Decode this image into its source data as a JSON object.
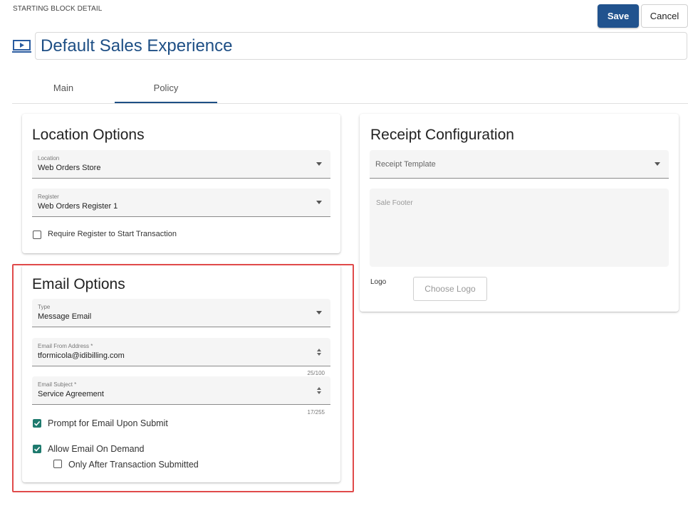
{
  "header": {
    "breadcrumb": "STARTING BLOCK DETAIL",
    "save_label": "Save",
    "cancel_label": "Cancel",
    "title": "Default Sales Experience",
    "title_icon": "presentation-icon"
  },
  "tabs": [
    {
      "label": "Main",
      "active": false
    },
    {
      "label": "Policy",
      "active": true
    }
  ],
  "location_options": {
    "heading": "Location Options",
    "location": {
      "label": "Location",
      "value": "Web Orders Store"
    },
    "register": {
      "label": "Register",
      "value": "Web Orders Register 1"
    },
    "require_register": {
      "label": "Require Register to Start Transaction",
      "checked": false
    }
  },
  "email_options": {
    "heading": "Email Options",
    "type": {
      "label": "Type",
      "value": "Message Email"
    },
    "from_address": {
      "label": "Email From Address *",
      "value": "tformicola@idibilling.com",
      "counter": "25/100"
    },
    "subject": {
      "label": "Email Subject *",
      "value": "Service Agreement",
      "counter": "17/255"
    },
    "prompt_email": {
      "label": "Prompt for Email Upon Submit",
      "checked": true
    },
    "allow_on_demand": {
      "label": "Allow Email On Demand",
      "checked": true
    },
    "only_after": {
      "label": "Only After Transaction Submitted",
      "checked": false
    }
  },
  "receipt_configuration": {
    "heading": "Receipt Configuration",
    "template_placeholder": "Receipt Template",
    "sale_footer_placeholder": "Sale Footer",
    "logo_label": "Logo",
    "choose_logo_label": "Choose Logo"
  },
  "colors": {
    "primary": "#21538e",
    "title": "#1e4f85",
    "checkbox": "#1e7a6e",
    "highlight": "#e04a4a"
  }
}
